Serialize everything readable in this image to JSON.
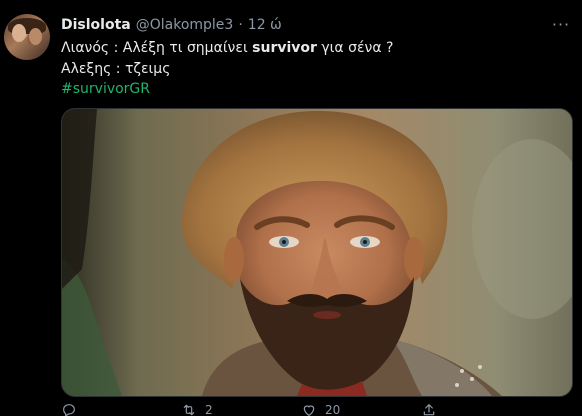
{
  "tweet": {
    "display_name": "Dislolota",
    "handle": "@Olakomple3",
    "separator": "·",
    "time": "12 ώ",
    "more_label": "···",
    "line1_prefix": "Λιανός : Αλέξη τι σημαίνει ",
    "line1_bold": "survivor",
    "line1_suffix": " για σένα ?",
    "line2": "Αλεξης : τζειμς",
    "hashtag": "#survivorGR"
  },
  "media": {
    "alt": "photo"
  },
  "actions": {
    "reply_count": "",
    "retweet_count": "2",
    "like_count": "20",
    "share_count": ""
  },
  "colors": {
    "background": "#000000",
    "text": "#e7e9ea",
    "secondary": "#8b98a5",
    "hashtag": "#21b46a"
  }
}
